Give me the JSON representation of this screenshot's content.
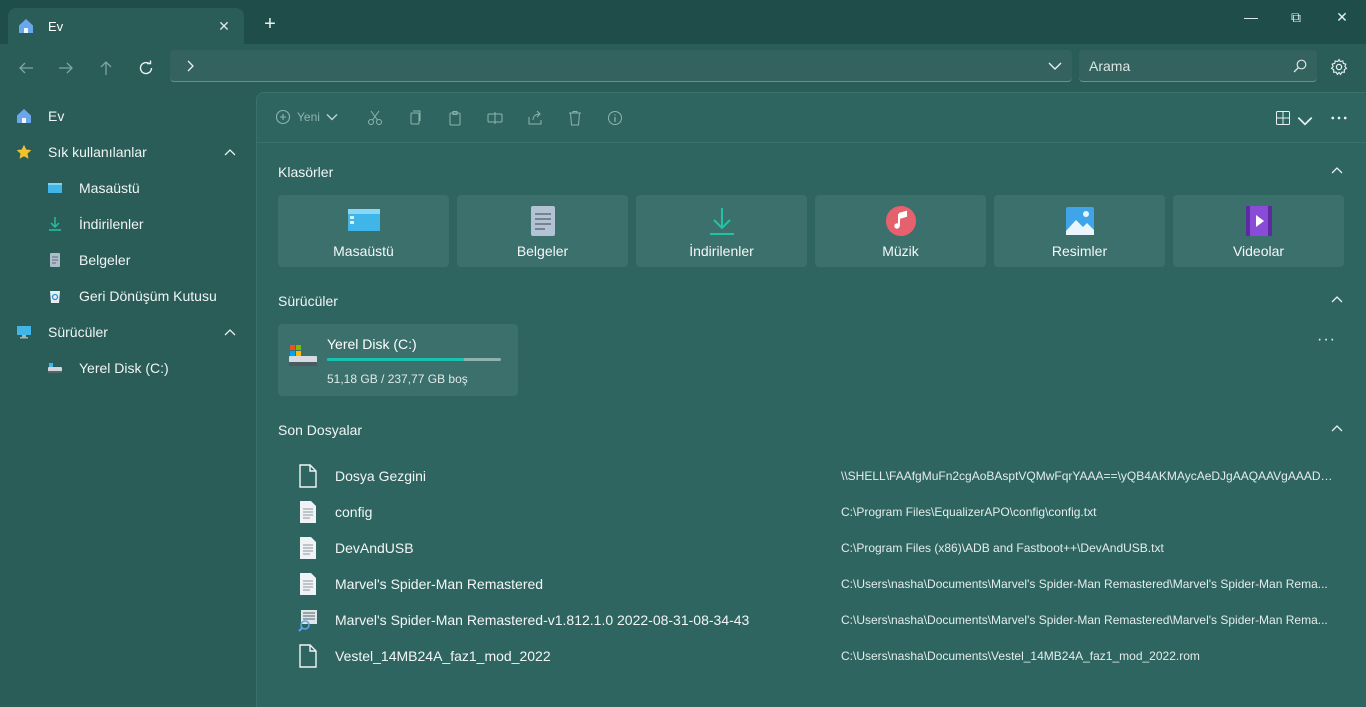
{
  "window": {
    "tab_title": "Ev",
    "new_tab": "+",
    "minimize": "—",
    "maximize": "⧉",
    "close": "✕"
  },
  "address_bar": {
    "path": "",
    "search_placeholder": "Arama"
  },
  "sidebar": {
    "items": [
      {
        "label": "Ev",
        "icon": "home-icon"
      },
      {
        "label": "Sık kullanılanlar",
        "icon": "star-icon",
        "expanded": true
      },
      {
        "label": "Masaüstü",
        "icon": "desktop-icon"
      },
      {
        "label": "İndirilenler",
        "icon": "download-icon"
      },
      {
        "label": "Belgeler",
        "icon": "documents-icon"
      },
      {
        "label": "Geri Dönüşüm Kutusu",
        "icon": "recycle-bin-icon"
      },
      {
        "label": "Sürücüler",
        "icon": "computer-icon",
        "expanded": true
      },
      {
        "label": "Yerel Disk (C:)",
        "icon": "drive-icon"
      }
    ]
  },
  "toolbar": {
    "new_label": "Yeni"
  },
  "sections": {
    "folders_title": "Klasörler",
    "drives_title": "Sürücüler",
    "recent_title": "Son Dosyalar"
  },
  "folders": [
    {
      "label": "Masaüstü",
      "icon": "desktop-icon"
    },
    {
      "label": "Belgeler",
      "icon": "documents-icon"
    },
    {
      "label": "İndirilenler",
      "icon": "download-icon"
    },
    {
      "label": "Müzik",
      "icon": "music-icon"
    },
    {
      "label": "Resimler",
      "icon": "pictures-icon"
    },
    {
      "label": "Videolar",
      "icon": "videos-icon"
    }
  ],
  "drive": {
    "name": "Yerel Disk (C:)",
    "free_text": "51,18 GB / 237,77 GB boş",
    "used_fraction": 0.785,
    "more": "···"
  },
  "recent_files": [
    {
      "name": "Dosya Gezgini",
      "path": "\\\\SHELL\\FAAfgMuFn2cgAoBAsptVQMwFqrYAAA==\\yQB4AKMAycAeDJgAAQAAVgAAADF...",
      "icon": "file-icon"
    },
    {
      "name": "config",
      "path": "C:\\Program Files\\EqualizerAPO\\config\\config.txt",
      "icon": "text-file-icon"
    },
    {
      "name": "DevAndUSB",
      "path": "C:\\Program Files (x86)\\ADB and Fastboot++\\DevAndUSB.txt",
      "icon": "text-file-icon"
    },
    {
      "name": "Marvel's Spider-Man Remastered",
      "path": "C:\\Users\\nasha\\Documents\\Marvel's Spider-Man Remastered\\Marvel's Spider-Man Rema...",
      "icon": "text-file-icon"
    },
    {
      "name": "Marvel's Spider-Man Remastered-v1.812.1.0 2022-08-31-08-34-43",
      "path": "C:\\Users\\nasha\\Documents\\Marvel's Spider-Man Remastered\\Marvel's Spider-Man Rema...",
      "icon": "dump-file-icon"
    },
    {
      "name": "Vestel_14MB24A_faz1_mod_2022",
      "path": "C:\\Users\\nasha\\Documents\\Vestel_14MB24A_faz1_mod_2022.rom",
      "icon": "file-icon"
    }
  ],
  "colors": {
    "background": "#2a5c58",
    "content": "#2f6561",
    "card": "#3b706c",
    "accent": "#17c2ae"
  }
}
